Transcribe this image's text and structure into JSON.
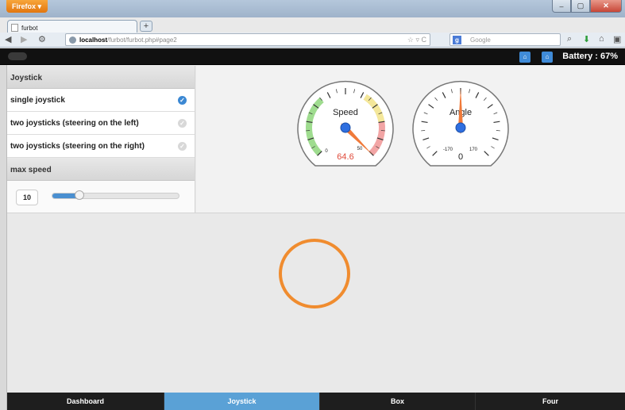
{
  "browser": {
    "app_button": "Firefox",
    "tab_title": "furbot",
    "url_host": "localhost",
    "url_path": "/furbot/furbot.php#page2",
    "search_placeholder": "Google"
  },
  "header": {
    "battery": "Battery : 67%"
  },
  "sidebar": {
    "section_joystick": "Joystick",
    "options": [
      {
        "label": "single joystick",
        "selected": true
      },
      {
        "label": "two joysticks (steering on the left)",
        "selected": false
      },
      {
        "label": "two joysticks (steering on the right)",
        "selected": false
      }
    ],
    "section_speed": "max speed",
    "max_speed": "10",
    "max_speed_fraction": 0.22
  },
  "gauges": {
    "speed": {
      "title": "Speed",
      "value": "64.6",
      "min": "0",
      "max": "50"
    },
    "angle": {
      "title": "Angle",
      "value": "0",
      "min": "-170",
      "max": "170"
    }
  },
  "bottom_nav": [
    {
      "label": "Dashboard",
      "active": false
    },
    {
      "label": "Joystick",
      "active": true
    },
    {
      "label": "Box",
      "active": false
    },
    {
      "label": "Four",
      "active": false
    }
  ],
  "colors": {
    "accent": "#5aa1d6",
    "joystick_ring": "#f08c2f",
    "needle": "#f07a3a",
    "hub": "#2f6fe0"
  }
}
